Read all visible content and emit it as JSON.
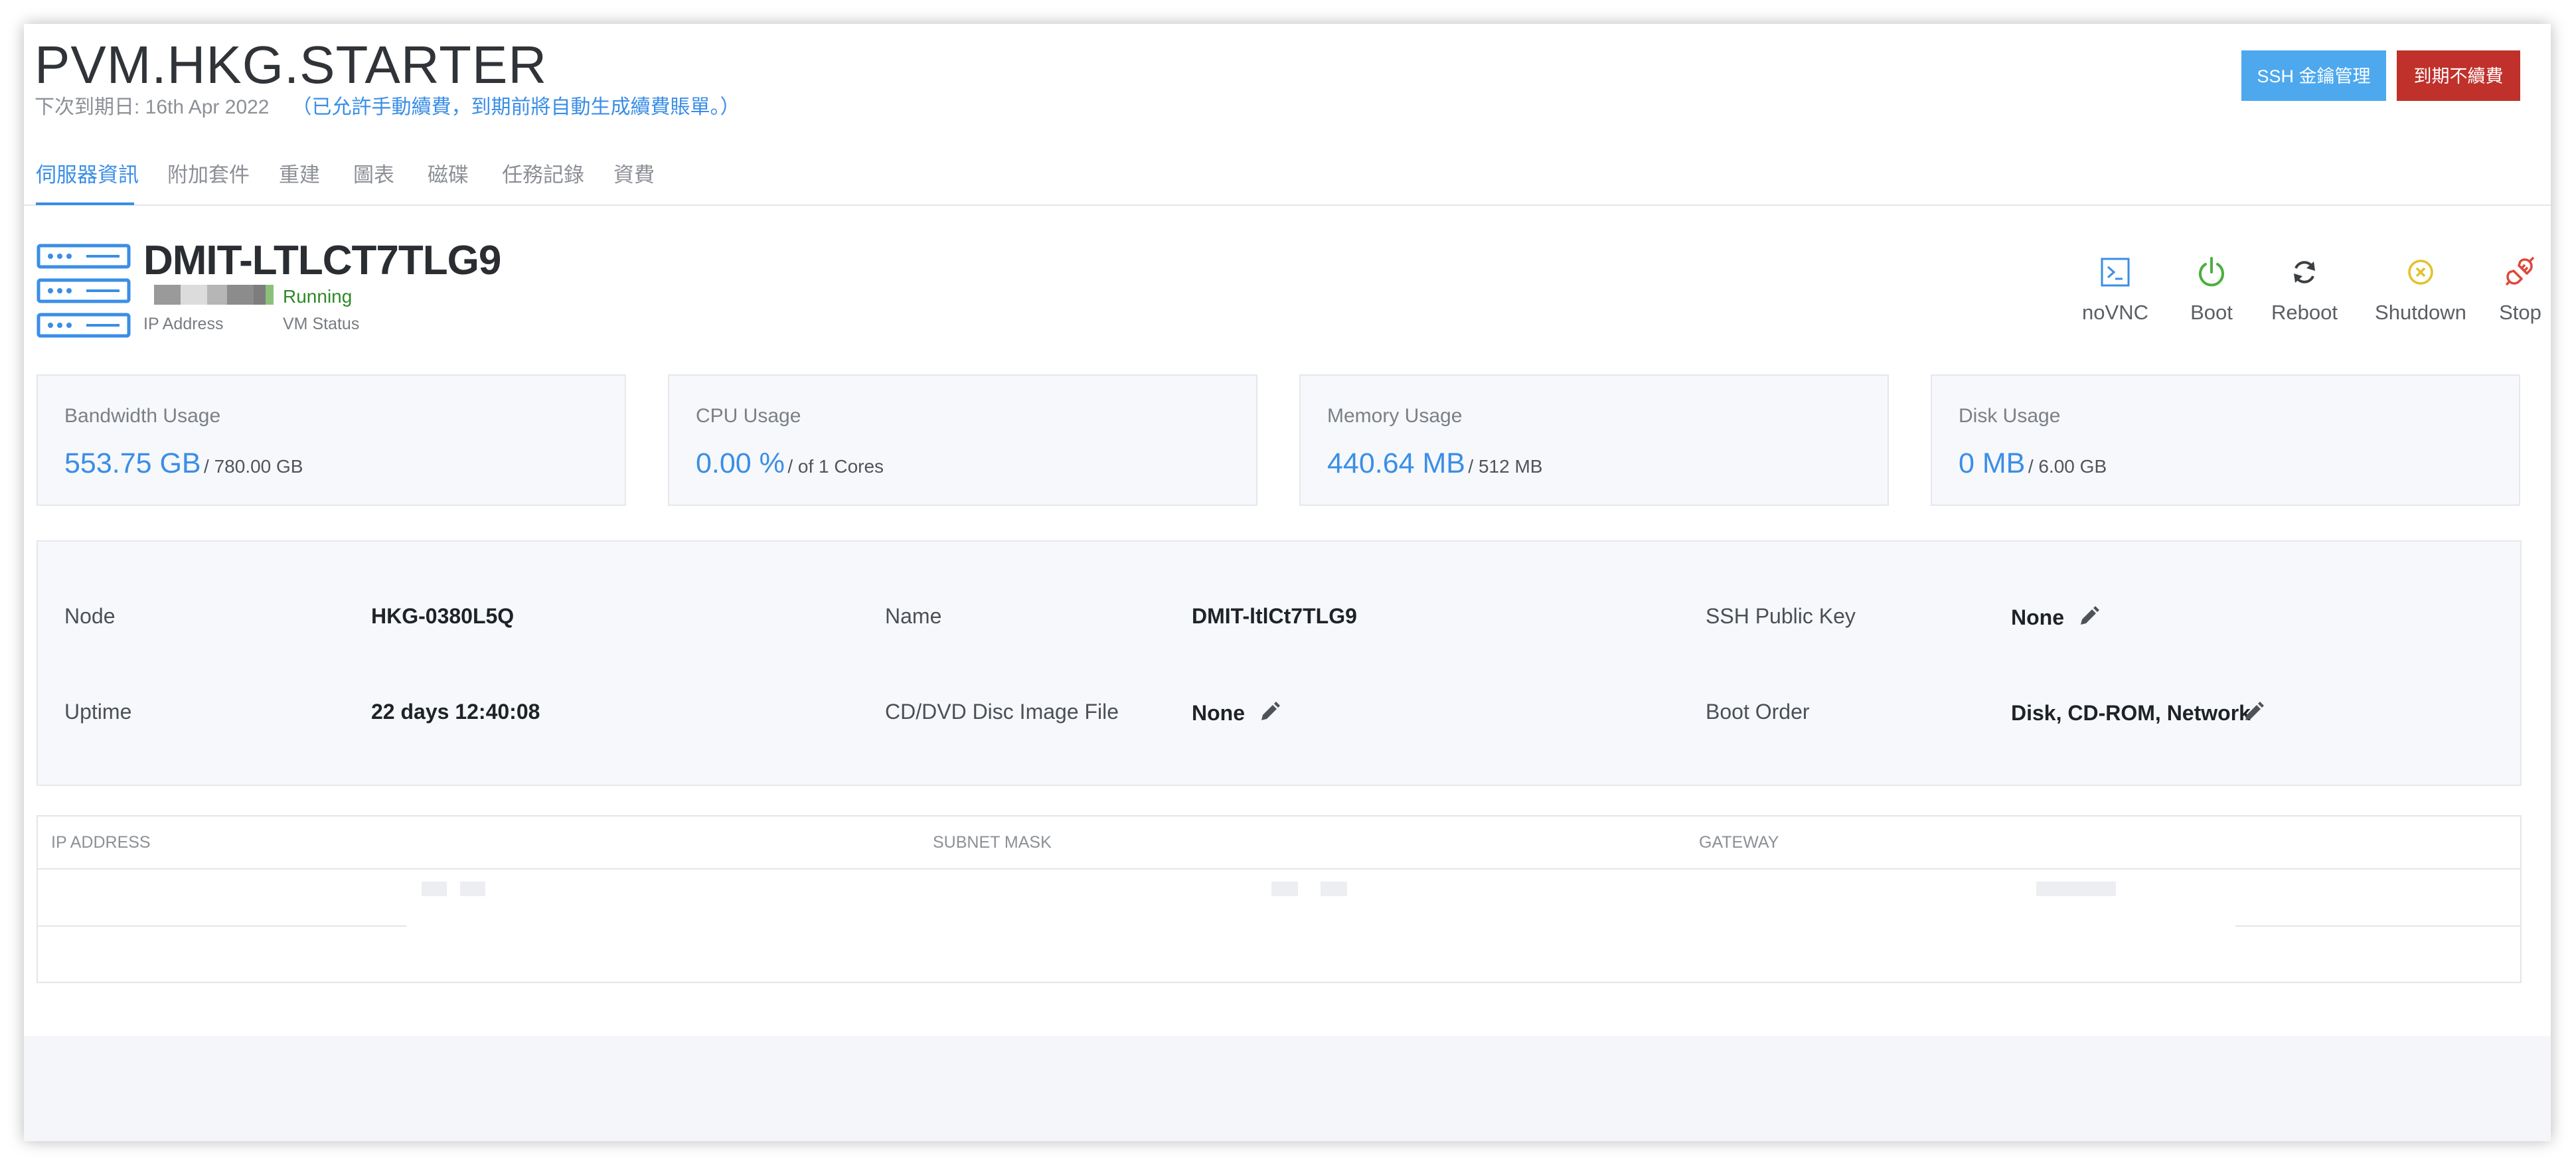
{
  "header": {
    "title": "PVM.HKG.STARTER",
    "due_label": "下次到期日: 16th Apr 2022",
    "renew_note": "（已允許手動續費，到期前將自動生成續費賬單。）"
  },
  "buttons": {
    "ssh": "SSH 金鑰管理",
    "no_renew": "到期不續費"
  },
  "tabs": [
    "伺服器資訊",
    "附加套件",
    "重建",
    "圖表",
    "磁碟",
    "任務記錄",
    "資費"
  ],
  "server": {
    "hostname": "DMIT-LTLCT7TLG9",
    "status": "Running",
    "ip_label": "IP Address",
    "status_label": "VM Status",
    "status_color": "#2d8a25"
  },
  "actions": [
    {
      "label": "noVNC",
      "icon": "terminal-icon",
      "color": "#3a8ee6"
    },
    {
      "label": "Boot",
      "icon": "power-icon",
      "color": "#4caf3f"
    },
    {
      "label": "Reboot",
      "icon": "refresh-icon",
      "color": "#3b3f44"
    },
    {
      "label": "Shutdown",
      "icon": "circle-x-icon",
      "color": "#e2c229"
    },
    {
      "label": "Stop",
      "icon": "unplug-icon",
      "color": "#e0463b"
    }
  ],
  "stats": [
    {
      "title": "Bandwidth Usage",
      "value": "553.75 GB",
      "total": "/ 780.00 GB"
    },
    {
      "title": "CPU Usage",
      "value": "0.00 %",
      "total": "/ of 1 Cores"
    },
    {
      "title": "Memory Usage",
      "value": "440.64 MB",
      "total": "/ 512 MB"
    },
    {
      "title": "Disk Usage",
      "value": "0 MB",
      "total": "/ 6.00 GB"
    }
  ],
  "details": {
    "node_label": "Node",
    "node": "HKG-0380L5Q",
    "name_label": "Name",
    "name": "DMIT-ltlCt7TLG9",
    "ssh_label": "SSH Public Key",
    "ssh": "None",
    "uptime_label": "Uptime",
    "uptime": "22 days 12:40:08",
    "cd_label": "CD/DVD Disc Image File",
    "cd": "None",
    "boot_label": "Boot Order",
    "boot": "Disk, CD-ROM, Network"
  },
  "network": {
    "headers": [
      "IP ADDRESS",
      "SUBNET MASK",
      "GATEWAY"
    ]
  },
  "colors": {
    "accent": "#3a8ee6",
    "ssh_button": "#4da8ee",
    "danger_button": "#c0312b"
  }
}
